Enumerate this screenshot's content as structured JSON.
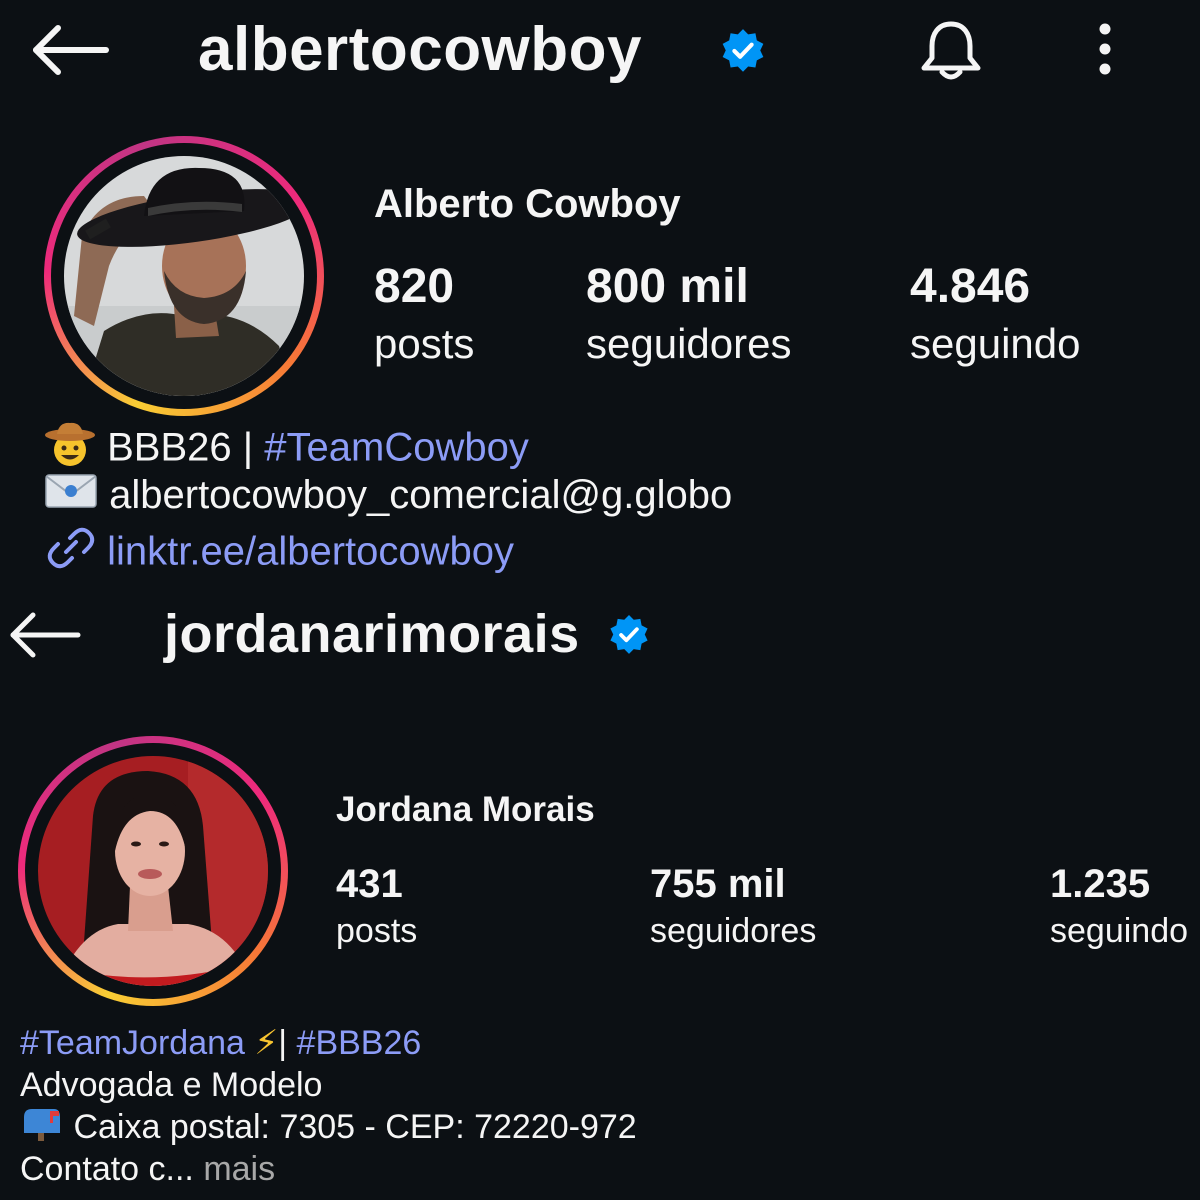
{
  "profiles": [
    {
      "username": "albertocowboy",
      "full_name": "Alberto Cowboy",
      "stats": [
        {
          "value": "820",
          "label": "posts"
        },
        {
          "value": "800 mil",
          "label": "seguidores"
        },
        {
          "value": "4.846",
          "label": "seguindo"
        }
      ],
      "bio": {
        "line1_text": "BBB26 | ",
        "line1_hashtag": "#TeamCowboy",
        "line1_emoji": "cowboy-hat-face-emoji",
        "line2_text": "albertocowboy_comercial@g.globo",
        "line2_emoji": "envelope-emoji",
        "link_text": "linktr.ee/albertocowboy",
        "link_icon": "link-icon"
      },
      "icons": {
        "back": "back-arrow-icon",
        "verified": "verified-badge-icon",
        "bell": "bell-icon",
        "more": "more-options-icon"
      }
    },
    {
      "username": "jordanarimorais",
      "full_name": "Jordana Morais",
      "stats": [
        {
          "value": "431",
          "label": "posts"
        },
        {
          "value": "755 mil",
          "label": "seguidores"
        },
        {
          "value": "1.235",
          "label": "seguindo"
        }
      ],
      "bio": {
        "hashtag1": "#TeamJordana",
        "lightning_emoji": "⚡",
        "separator": "|",
        "hashtag2": "#BBB26",
        "line2": "Advogada e Modelo",
        "line3_emoji": "mailbox-emoji",
        "line3_text": "Caixa postal: 7305 - CEP: 72220-972",
        "line4_text": "Contato c...",
        "more_label": "mais"
      },
      "icons": {
        "back": "back-arrow-icon",
        "verified": "verified-badge-icon"
      }
    }
  ],
  "colors": {
    "background": "#0c1014",
    "text": "#f5f5f5",
    "link": "#8c9cf6",
    "verified": "#0095f6",
    "muted": "#a8a8a8"
  }
}
